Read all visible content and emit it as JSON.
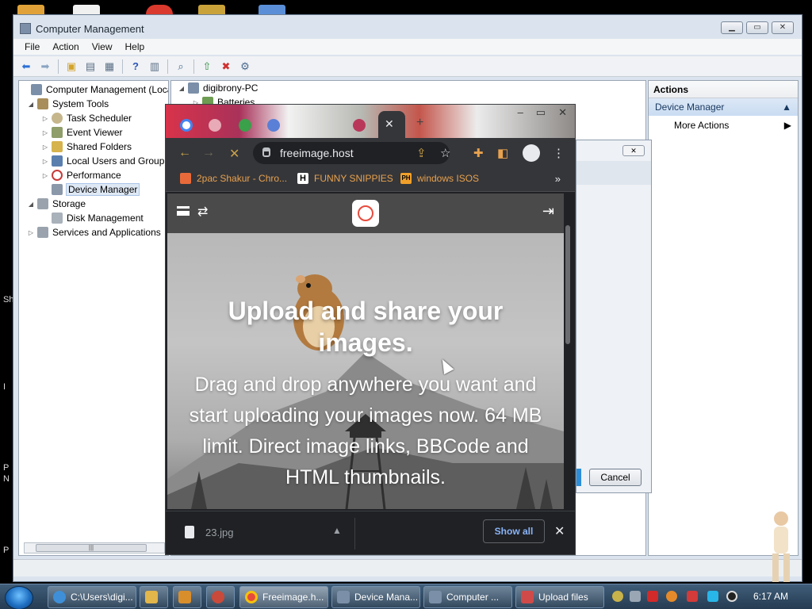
{
  "desktop": {
    "edge_labels": [
      "Sh",
      "I",
      "P",
      "N",
      "P"
    ]
  },
  "cm": {
    "title": "Computer Management",
    "menu": [
      "File",
      "Action",
      "View",
      "Help"
    ],
    "tree": [
      {
        "label": "Computer Management (Local",
        "level": 0,
        "arrow": ""
      },
      {
        "label": "System Tools",
        "level": 1,
        "arrow": "◢"
      },
      {
        "label": "Task Scheduler",
        "level": 2,
        "arrow": "▷"
      },
      {
        "label": "Event Viewer",
        "level": 2,
        "arrow": "▷"
      },
      {
        "label": "Shared Folders",
        "level": 2,
        "arrow": "▷"
      },
      {
        "label": "Local Users and Group",
        "level": 2,
        "arrow": "▷"
      },
      {
        "label": "Performance",
        "level": 2,
        "arrow": "▷"
      },
      {
        "label": "Device Manager",
        "level": 2,
        "arrow": "",
        "selected": true
      },
      {
        "label": "Storage",
        "level": 1,
        "arrow": "◢"
      },
      {
        "label": "Disk Management",
        "level": 2,
        "arrow": ""
      },
      {
        "label": "Services and Applications",
        "level": 1,
        "arrow": "▷"
      }
    ],
    "middle": {
      "root": "digibrony-PC",
      "child": "Batteries"
    },
    "actions": {
      "header": "Actions",
      "section": "Device Manager",
      "item": "More Actions"
    },
    "dialog": {
      "cancel": "Cancel"
    }
  },
  "chrome": {
    "url": "freeimage.host",
    "bookmarks": [
      {
        "label": "2pac Shakur - Chro...",
        "color": "#e86a3a"
      },
      {
        "label": "FUNNY SNIPPIES",
        "color": "#ffffff"
      },
      {
        "label": "windows ISOS",
        "color": "#f0a02a"
      }
    ],
    "page": {
      "title": "Upload and share your images.",
      "subtitle": "Drag and drop anywhere you want and start uploading your images now. 64 MB limit. Direct image links, BBCode and HTML thumbnails."
    },
    "download": {
      "file": "23.jpg",
      "show_all": "Show all"
    }
  },
  "taskbar": {
    "tasks": [
      {
        "label": "C:\\Users\\digi...",
        "icon_color": "#3e8fd8"
      },
      {
        "label": "",
        "icon_color": "#e2b64a"
      },
      {
        "label": "",
        "icon_color": "#d98e2c"
      },
      {
        "label": "",
        "icon_color": "#c94a3a"
      },
      {
        "label": "Freeimage.h...",
        "icon_color": "#e74b3c"
      },
      {
        "label": "Device Mana...",
        "icon_color": "#7b8fa8"
      },
      {
        "label": "Computer ...",
        "icon_color": "#7b8fa8"
      },
      {
        "label": "Upload files",
        "icon_color": "#d04a4a"
      }
    ],
    "clock": "6:17 AM"
  }
}
